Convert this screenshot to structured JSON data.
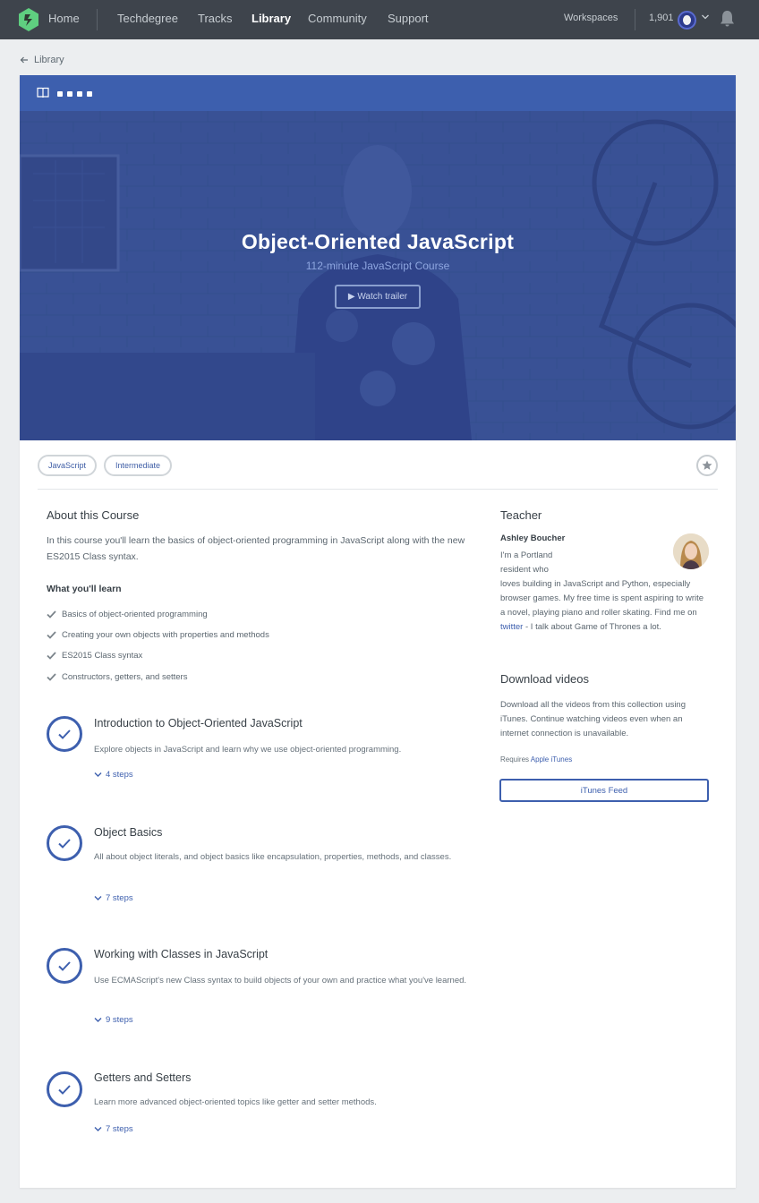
{
  "nav": {
    "home": "Home",
    "links": [
      "Techdegree",
      "Tracks",
      "Library",
      "Community",
      "Support"
    ],
    "workspaces": "Workspaces",
    "points": "1,901"
  },
  "breadcrumb": {
    "label": "Library"
  },
  "hero": {
    "title": "Object-Oriented JavaScript",
    "subtitle": "112-minute JavaScript Course",
    "trailer": "▶ Watch trailer"
  },
  "tags": [
    "JavaScript",
    "Intermediate"
  ],
  "about": {
    "heading": "About this Course",
    "description": "In this course you'll learn the basics of object-oriented programming in JavaScript along with the new ES2015 Class syntax.",
    "learn_heading": "What you'll learn",
    "learn_items": [
      "Basics of object-oriented programming",
      "Creating your own objects with properties and methods",
      "ES2015 Class syntax",
      "Constructors, getters, and setters"
    ]
  },
  "stages": [
    {
      "title": "Introduction to Object-Oriented JavaScript",
      "description": "Explore objects in JavaScript and learn why we use object-oriented programming.",
      "steps": "4 steps"
    },
    {
      "title": "Object Basics",
      "description": "All about object literals, and object basics like encapsulation, properties, methods, and classes.",
      "steps": "7 steps"
    },
    {
      "title": "Working with Classes in JavaScript",
      "description": "Use ECMAScript's new Class syntax to build objects of your own and practice what you've learned.",
      "steps": "9 steps"
    },
    {
      "title": "Getters and Setters",
      "description": "Learn more advanced object-oriented topics like getter and setter methods.",
      "steps": "7 steps"
    }
  ],
  "teacher": {
    "heading": "Teacher",
    "name": "Ashley Boucher",
    "bio_before": "I'm a Portland resident who loves building in JavaScript and Python, especially browser games. My free time is spent aspiring to write a novel, playing piano and roller skating. Find me on ",
    "bio_link": "twitter",
    "bio_after": " - I talk about Game of Thrones a lot."
  },
  "download": {
    "heading": "Download videos",
    "text": "Download all the videos from this collection using iTunes. Continue watching videos even when an internet connection is unavailable.",
    "requires": "Requires",
    "requires_link": "Apple iTunes",
    "button": "iTunes Feed"
  },
  "colors": {
    "nav": "#3e444c",
    "brand": "#3d5fae",
    "hero": "#3b5498",
    "logo": "#5fcf80"
  }
}
